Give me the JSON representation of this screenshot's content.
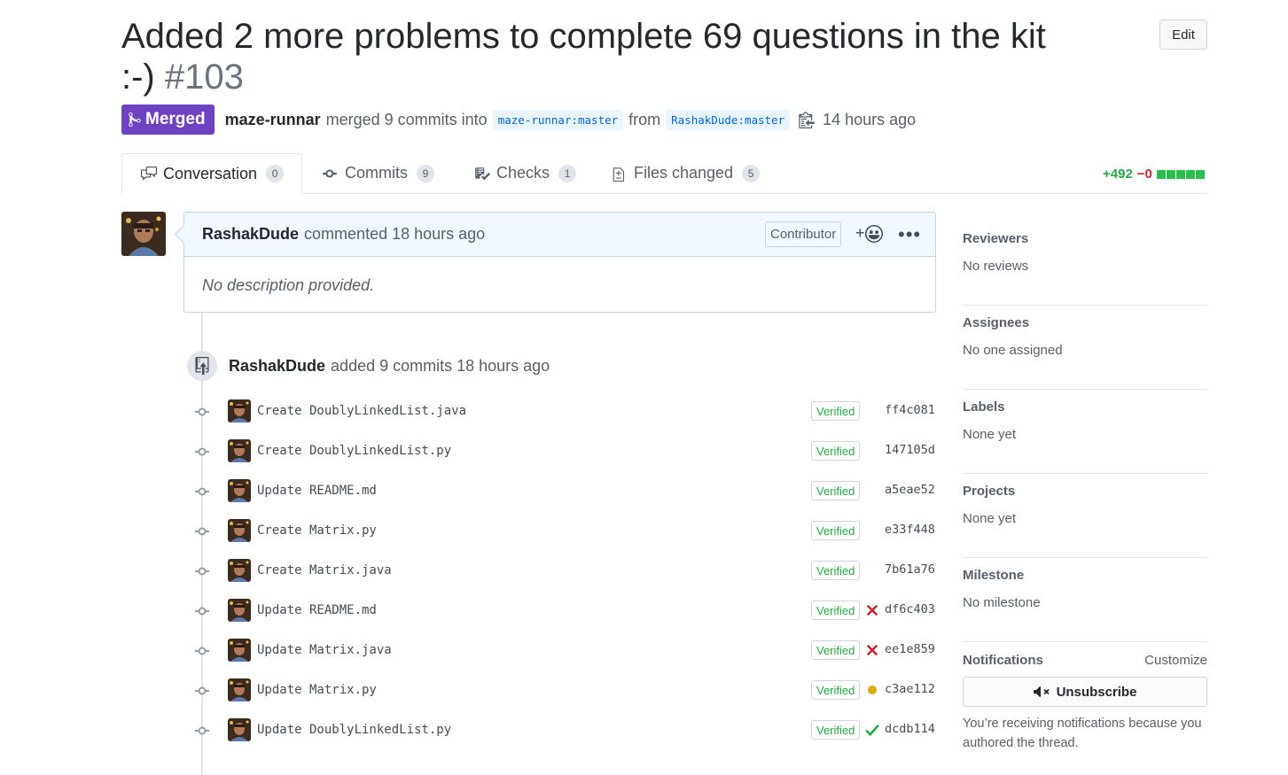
{
  "pr": {
    "title": "Added 2 more problems to complete 69 questions in the kit :-)",
    "number": "#103",
    "edit_label": "Edit",
    "state_label": "Merged",
    "merged_by": "maze-runnar",
    "merged_text": "merged 9 commits into",
    "base_branch": "maze-runnar:master",
    "from_text": "from",
    "head_branch": "RashakDude:master",
    "merged_time": "14 hours ago"
  },
  "tabs": [
    {
      "label": "Conversation",
      "count": "0",
      "icon": "comment-discussion-icon"
    },
    {
      "label": "Commits",
      "count": "9",
      "icon": "commit-icon"
    },
    {
      "label": "Checks",
      "count": "1",
      "icon": "checklist-icon"
    },
    {
      "label": "Files changed",
      "count": "5",
      "icon": "file-diff-icon"
    }
  ],
  "diffstat": {
    "additions": "+492",
    "deletions": "−0",
    "blocks": 5
  },
  "comment": {
    "author": "RashakDude",
    "action": "commented 18 hours ago",
    "role": "Contributor",
    "body": "No description provided.",
    "reaction_plus": "+"
  },
  "push": {
    "author": "RashakDude",
    "text": "added 9 commits 18 hours ago"
  },
  "commits": [
    {
      "message": "Create DoublyLinkedList.java",
      "verified": "Verified",
      "status": "none",
      "sha": "ff4c081"
    },
    {
      "message": "Create DoublyLinkedList.py",
      "verified": "Verified",
      "status": "none",
      "sha": "147105d"
    },
    {
      "message": "Update README.md",
      "verified": "Verified",
      "status": "none",
      "sha": "a5eae52"
    },
    {
      "message": "Create Matrix.py",
      "verified": "Verified",
      "status": "none",
      "sha": "e33f448"
    },
    {
      "message": "Create Matrix.java",
      "verified": "Verified",
      "status": "none",
      "sha": "7b61a76"
    },
    {
      "message": "Update README.md",
      "verified": "Verified",
      "status": "failure",
      "sha": "df6c403"
    },
    {
      "message": "Update Matrix.java",
      "verified": "Verified",
      "status": "failure",
      "sha": "ee1e859"
    },
    {
      "message": "Update Matrix.py",
      "verified": "Verified",
      "status": "pending",
      "sha": "c3ae112"
    },
    {
      "message": "Update DoublyLinkedList.py",
      "verified": "Verified",
      "status": "success",
      "sha": "dcdb114"
    }
  ],
  "sidebar": {
    "reviewers": {
      "heading": "Reviewers",
      "value": "No reviews"
    },
    "assignees": {
      "heading": "Assignees",
      "value": "No one assigned"
    },
    "labels": {
      "heading": "Labels",
      "value": "None yet"
    },
    "projects": {
      "heading": "Projects",
      "value": "None yet"
    },
    "milestone": {
      "heading": "Milestone",
      "value": "No milestone"
    },
    "notifications": {
      "heading": "Notifications",
      "customize": "Customize",
      "button": "Unsubscribe",
      "note": "You’re receiving notifications because you authored the thread."
    }
  },
  "colors": {
    "merged": "#6f42c1",
    "additions": "#28a745",
    "deletions": "#cb2431",
    "failure": "#cb2431",
    "pending": "#dbab09",
    "success": "#28a745"
  }
}
